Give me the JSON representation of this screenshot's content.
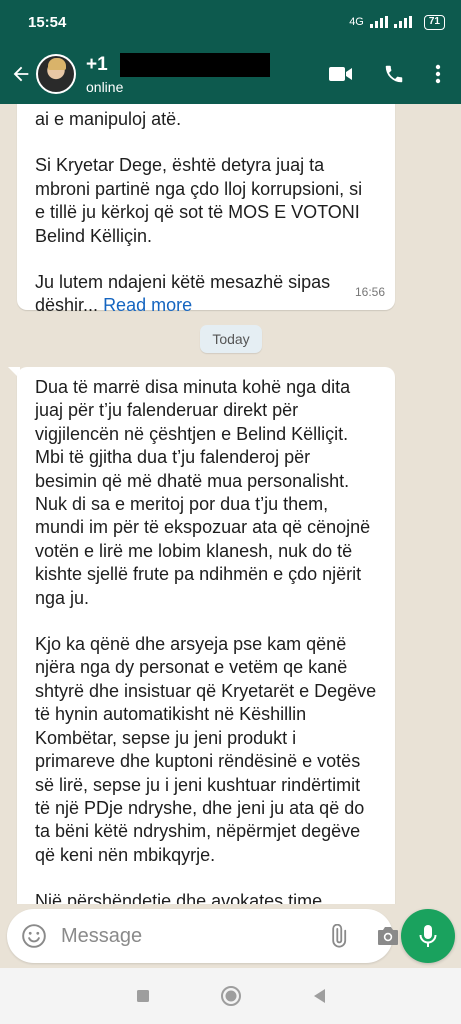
{
  "status_bar": {
    "time": "15:54",
    "network": "4G",
    "battery": "71"
  },
  "header": {
    "contact_name": "+1",
    "contact_status": "online",
    "icons": [
      "back-arrow-icon",
      "avatar",
      "video-call-icon",
      "phone-call-icon",
      "more-options-icon"
    ]
  },
  "messages": [
    {
      "paragraphs": [
        "ai e manipuloj atë.",
        "Si Kryetar Dege, është detyra juaj ta mbroni partinë nga çdo lloj korrupsioni, si e tillë ju kërkoj që sot të MOS E VOTONI Belind Këlliçin.",
        "Ju lutem ndajeni këtë mesazhë sipas dëshir..."
      ],
      "read_more": "Read more",
      "time": "16:56"
    },
    {
      "paragraphs": [
        "Dua të marrë disa minuta kohë nga dita juaj për t’ju falenderuar direkt për vigjilencën në çështjen e Belind Këlliçit. Mbi të gjitha dua t’ju falenderoj për besimin që më dhatë mua personalisht. Nuk di sa e meritoj por dua t’ju them, mundi im për të ekspozuar ata që cënojnë votën e lirë me lobim klanesh, nuk do të kishte sjellë frute pa ndihmën e çdo njërit nga ju.",
        "Kjo ka qënë dhe arsyeja pse kam qënë njëra nga dy personat e vetëm qe kanë shtyrë dhe insistuar që Kryetarët e Degëve të hynin automatikisht në Këshillin Kombëtar, sepse ju jeni produkt i primareve dhe kuptoni rëndësinë e votës së lirë, sepse ju i jeni kushtuar rindërtimit të një PDje ndryshe, dhe jeni ju ata që do ta bëni këtë ndryshim, nëpërmjet degëve që keni nën mbikqyrje.",
        "Një përshëndetje dhe avokates time Endira Bushati që më ka ndenjur shumë"
      ]
    }
  ],
  "date_divider": "Today",
  "composer": {
    "placeholder": "Message"
  },
  "colors": {
    "header": "#0d5a4e",
    "mic_button": "#1aa25e",
    "chat_background": "#e9e2d6",
    "link": "#1565c0"
  }
}
